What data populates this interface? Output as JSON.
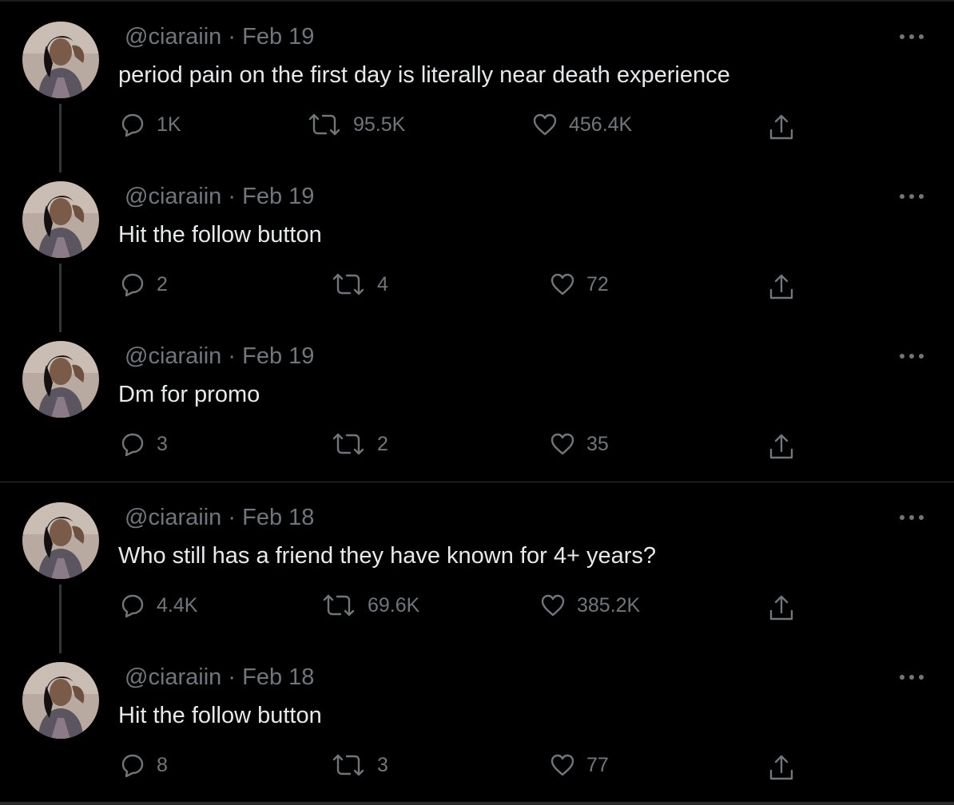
{
  "theme": {
    "background": "#000000",
    "text": "#e7e9ea",
    "muted": "#71767b",
    "line": "#333639"
  },
  "tweets": [
    {
      "handle": "@ciaraiin",
      "sep": "·",
      "date": "Feb 19",
      "text": "period pain on the first day is literally near death experience",
      "replies": "1K",
      "retweets": "95.5K",
      "likes": "456.4K",
      "thread_line": true,
      "icons": {
        "reply": "reply-icon",
        "retweet": "retweet-icon",
        "like": "heart-icon",
        "share": "share-icon",
        "more": "more-icon"
      }
    },
    {
      "handle": "@ciaraiin",
      "sep": "·",
      "date": "Feb 19",
      "text": "Hit the follow button",
      "replies": "2",
      "retweets": "4",
      "likes": "72",
      "thread_line": true,
      "icons": {
        "reply": "reply-icon",
        "retweet": "retweet-icon",
        "like": "heart-icon",
        "share": "share-icon",
        "more": "more-icon"
      }
    },
    {
      "handle": "@ciaraiin",
      "sep": "·",
      "date": "Feb 19",
      "text": "Dm for promo",
      "replies": "3",
      "retweets": "2",
      "likes": "35",
      "thread_line": false,
      "icons": {
        "reply": "reply-icon",
        "retweet": "retweet-icon",
        "like": "heart-icon",
        "share": "share-icon",
        "more": "more-icon"
      }
    },
    {
      "handle": "@ciaraiin",
      "sep": "·",
      "date": "Feb 18",
      "text": "Who still has a friend they have known for 4+ years?",
      "replies": "4.4K",
      "retweets": "69.6K",
      "likes": "385.2K",
      "thread_line": true,
      "icons": {
        "reply": "reply-icon",
        "retweet": "retweet-icon",
        "like": "heart-icon",
        "share": "share-icon",
        "more": "more-icon"
      }
    },
    {
      "handle": "@ciaraiin",
      "sep": "·",
      "date": "Feb 18",
      "text": "Hit the follow button",
      "replies": "8",
      "retweets": "3",
      "likes": "77",
      "thread_line": false,
      "icons": {
        "reply": "reply-icon",
        "retweet": "retweet-icon",
        "like": "heart-icon",
        "share": "share-icon",
        "more": "more-icon"
      }
    }
  ]
}
